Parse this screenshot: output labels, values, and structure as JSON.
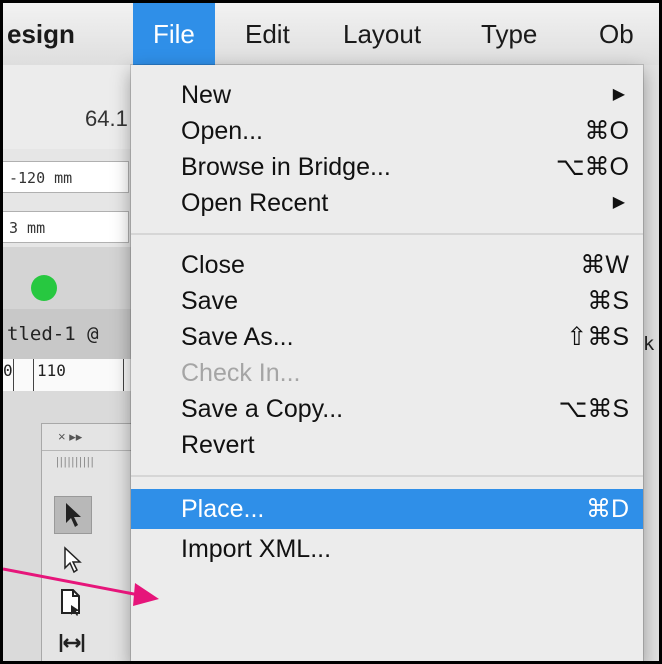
{
  "menubar": {
    "app": "esign",
    "file": "File",
    "edit": "Edit",
    "layout": "Layout",
    "type": "Type",
    "object": "Ob"
  },
  "background": {
    "zoom": "64.1",
    "field1": "-120 mm",
    "field2": "3 mm",
    "doc_tab": "tled-1 @",
    "ruler_a": "0",
    "ruler_b": "110",
    "tools_header": "×  ▸▸"
  },
  "file_menu": {
    "items": [
      {
        "label": "New",
        "shortcut": "",
        "submenu": true
      },
      {
        "label": "Open...",
        "shortcut": "⌘O"
      },
      {
        "label": "Browse in Bridge...",
        "shortcut": "⌥⌘O"
      },
      {
        "label": "Open Recent",
        "shortcut": "",
        "submenu": true
      },
      {
        "label": "Close",
        "shortcut": "⌘W"
      },
      {
        "label": "Save",
        "shortcut": "⌘S"
      },
      {
        "label": "Save As...",
        "shortcut": "⇧⌘S"
      },
      {
        "label": "Check In...",
        "shortcut": "",
        "disabled": true
      },
      {
        "label": "Save a Copy...",
        "shortcut": "⌥⌘S"
      },
      {
        "label": "Revert",
        "shortcut": ""
      },
      {
        "label": "Place...",
        "shortcut": "⌘D",
        "highlighted": true
      },
      {
        "label": "Import XML...",
        "shortcut": ""
      }
    ]
  },
  "colors": {
    "highlight": "#2f8fe8",
    "annotation_arrow": "#e6157a",
    "green_light": "#27c840"
  }
}
